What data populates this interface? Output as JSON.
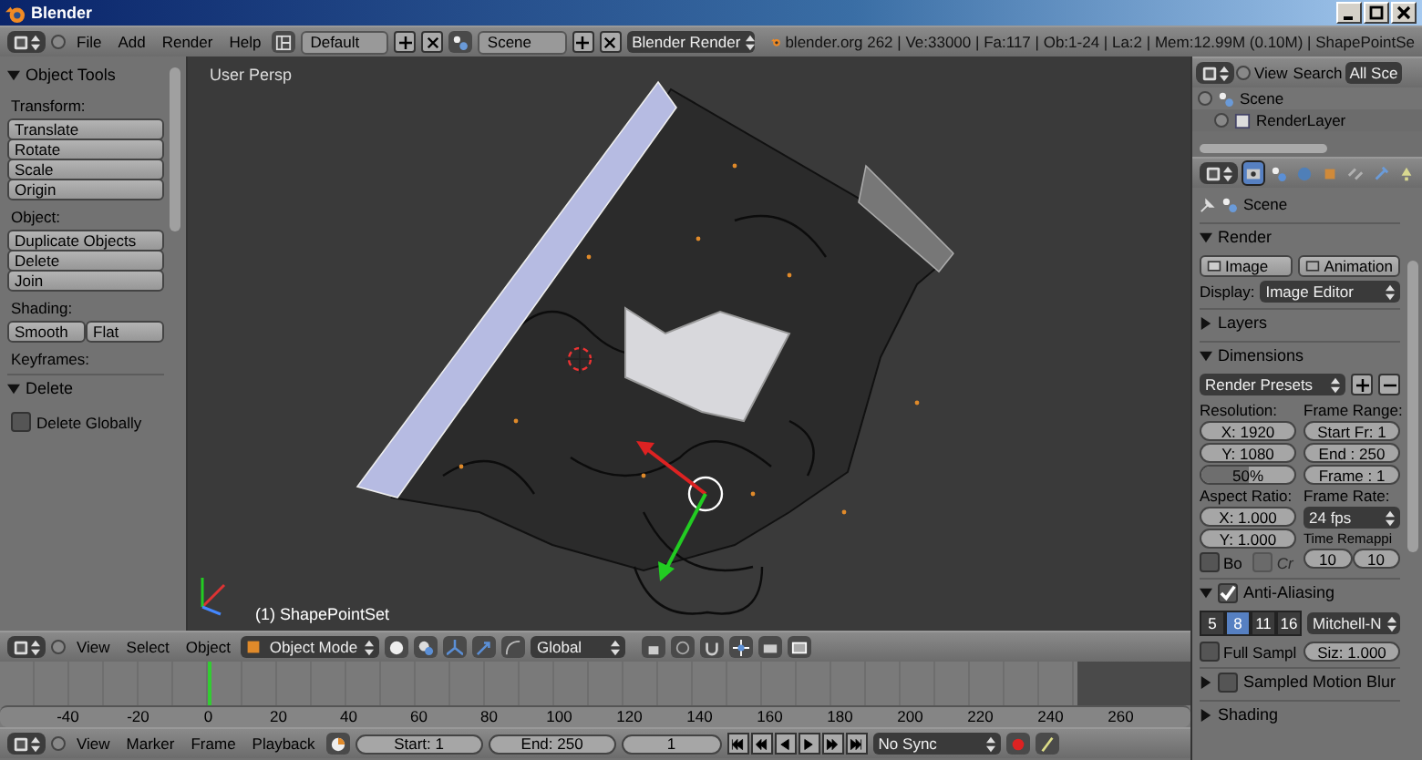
{
  "window": {
    "title": "Blender"
  },
  "info_header": {
    "menus": [
      "File",
      "Add",
      "Render",
      "Help"
    ],
    "layout": "Default",
    "scene": "Scene",
    "engine": "Blender Render",
    "stats": "blender.org 262 | Ve:33000 | Fa:117 | Ob:1-24 | La:2 | Mem:12.99M (0.10M) | ShapePointSe"
  },
  "tool_shelf": {
    "title": "Object Tools",
    "sections": [
      {
        "label": "Transform:",
        "kind": "column",
        "buttons": [
          "Translate",
          "Rotate",
          "Scale"
        ]
      },
      {
        "kind": "column",
        "buttons": [
          "Origin"
        ]
      },
      {
        "label": "Object:",
        "kind": "column",
        "buttons": [
          "Duplicate Objects",
          "Delete",
          "Join"
        ]
      },
      {
        "label": "Shading:",
        "kind": "row",
        "buttons": [
          "Smooth",
          "Flat"
        ]
      },
      {
        "label": "Keyframes:",
        "kind": "label"
      }
    ],
    "operator_panel": {
      "title": "Delete",
      "options": [
        {
          "label": "Delete Globally",
          "checked": false
        }
      ]
    }
  },
  "viewport": {
    "view_label": "User Persp",
    "object_label": "(1) ShapePointSet"
  },
  "view3d_header": {
    "menus": [
      "View",
      "Select",
      "Object"
    ],
    "mode": "Object Mode",
    "orientation": "Global"
  },
  "timeline": {
    "ruler_labels": [
      "-40",
      "-20",
      "0",
      "20",
      "40",
      "60",
      "80",
      "100",
      "120",
      "140",
      "160",
      "180",
      "200",
      "220",
      "240",
      "260"
    ]
  },
  "timeline_header": {
    "menus": [
      "View",
      "Marker",
      "Frame",
      "Playback"
    ],
    "start": "Start: 1",
    "end": "End: 250",
    "frame": "1",
    "sync": "No Sync"
  },
  "outliner": {
    "menus": [
      "View",
      "Search"
    ],
    "filter": "All Sce",
    "tree": [
      {
        "label": "Scene",
        "children": [
          {
            "label": "RenderLayer"
          }
        ]
      }
    ]
  },
  "properties": {
    "tabs": [
      {
        "kind": "render",
        "selected": true
      },
      {
        "kind": "scene",
        "selected": false
      },
      {
        "kind": "world",
        "selected": false
      },
      {
        "kind": "object",
        "selected": false
      },
      {
        "kind": "constraints",
        "selected": false
      },
      {
        "kind": "modifiers",
        "selected": false
      },
      {
        "kind": "data",
        "selected": false
      }
    ],
    "context": "Scene",
    "render": {
      "title": "Render",
      "buttons": [
        "Image",
        "Animation"
      ],
      "display_label": "Display:",
      "display": "Image Editor"
    },
    "layers": {
      "title": "Layers"
    },
    "dimensions": {
      "title": "Dimensions",
      "presets": "Render Presets",
      "resolution_label": "Resolution:",
      "res_x": "X: 1920",
      "res_y": "Y: 1080",
      "percent": {
        "text": "50%",
        "level": 0.5
      },
      "frame_range_label": "Frame Range:",
      "start": "Start Fr: 1",
      "end": "End : 250",
      "frame": "Frame : 1",
      "aspect_label": "Aspect Ratio:",
      "aspect_x": "X: 1.000",
      "aspect_y": "Y: 1.000",
      "frame_rate_label": "Frame Rate:",
      "frame_rate": "24 fps",
      "remap_label": "Time Remappi",
      "remap_old": "10",
      "remap_new": "10",
      "options": [
        {
          "label": "Bo",
          "checked": false,
          "disabled": false
        },
        {
          "label": "Cr",
          "checked": false,
          "disabled": true
        }
      ]
    },
    "anti_aliasing": {
      "title": "Anti-Aliasing",
      "checked": true,
      "samples": [
        {
          "label": "5",
          "selected": false
        },
        {
          "label": "8",
          "selected": true
        },
        {
          "label": "11",
          "selected": false
        },
        {
          "label": "16",
          "selected": false
        }
      ],
      "filter": "Mitchell-N",
      "full_sample": {
        "label": "Full Sampl",
        "checked": false
      },
      "size": "Siz: 1.000"
    },
    "motion_blur": {
      "title": "Sampled Motion Blur",
      "checked": false
    },
    "shading": {
      "title": "Shading"
    }
  }
}
